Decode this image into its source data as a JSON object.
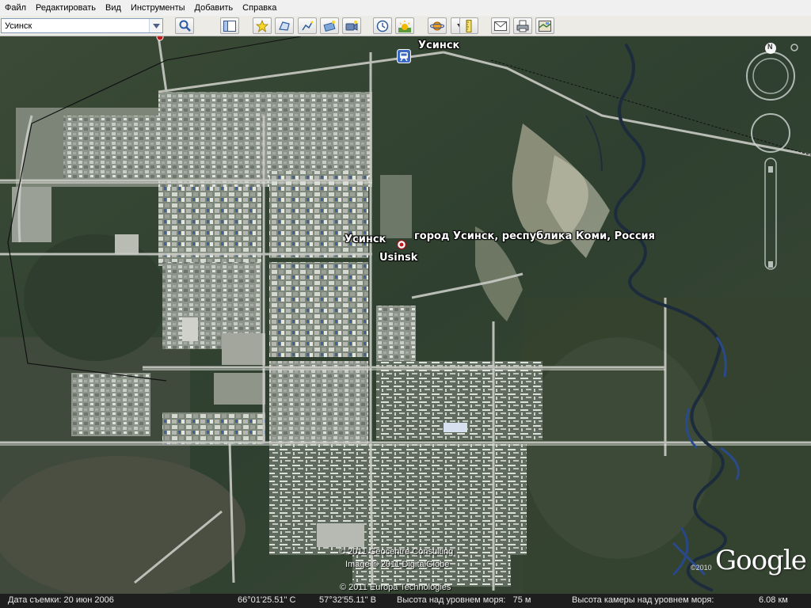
{
  "menu": {
    "items": [
      {
        "label": "Файл"
      },
      {
        "label": "Редактировать"
      },
      {
        "label": "Вид"
      },
      {
        "label": "Инструменты"
      },
      {
        "label": "Добавить"
      },
      {
        "label": "Справка"
      }
    ]
  },
  "search": {
    "value": "Усинск"
  },
  "map": {
    "labels": {
      "town_top": "Усинск",
      "town_center_ru": "Усинск",
      "town_center_en": "Usinsk",
      "town_description": "город Усинск, республика Коми, Россия"
    },
    "copyrights": {
      "geocentre": "© 2011 Geocentre Consulting",
      "digitalglobe": "Image © 2011 DigitalGlobe",
      "europa": "© 2011 Europa Technologies"
    },
    "google_logo": "Google",
    "google_year": "©2010",
    "compass_north": "N"
  },
  "status": {
    "imagery_date": "Дата съемки: 20 июн 2006",
    "latitude": "66°01'25.51\" С",
    "longitude": "57°32'55.11\" В",
    "elevation": "Высота над уровнем моря:   75 м",
    "eye_altitude": "Высота камеры над уровнем моря:",
    "eye_altitude_value": "6.08 км"
  }
}
